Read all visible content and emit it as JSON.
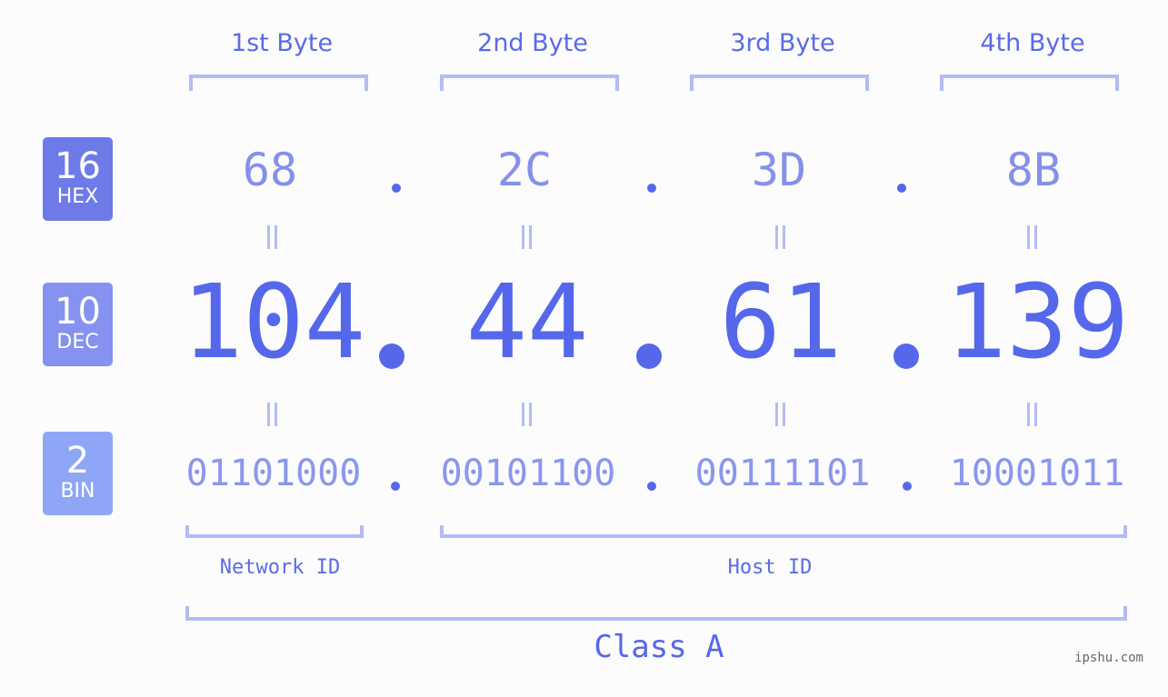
{
  "badges": [
    {
      "base": "16",
      "name": "HEX",
      "color": "#6d7ae8"
    },
    {
      "base": "10",
      "name": "DEC",
      "color": "#8592ef"
    },
    {
      "base": "2",
      "name": "BIN",
      "color": "#8fa6f7"
    }
  ],
  "bytes": [
    {
      "label": "1st Byte",
      "hex": "68",
      "dec": "104",
      "bin": "01101000"
    },
    {
      "label": "2nd Byte",
      "hex": "2C",
      "dec": "44",
      "bin": "00101100"
    },
    {
      "label": "3rd Byte",
      "hex": "3D",
      "dec": "61",
      "bin": "00111101"
    },
    {
      "label": "4th Byte",
      "hex": "8B",
      "dec": "139",
      "bin": "10001011"
    }
  ],
  "ip_address": "104.44.61.139",
  "network_id_label": "Network ID",
  "host_id_label": "Host ID",
  "class_label": "Class A",
  "watermark": "ipshu.com"
}
